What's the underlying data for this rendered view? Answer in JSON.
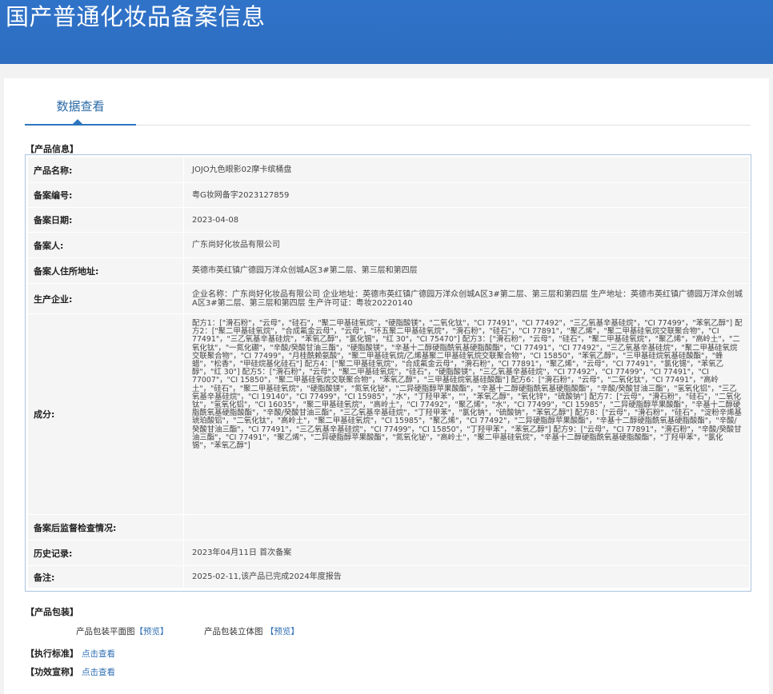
{
  "header": {
    "title": "国产普通化妆品备案信息"
  },
  "tab": {
    "label": "数据查看"
  },
  "sections": {
    "product_info": "【产品信息】",
    "packaging": "【产品包装】",
    "exec_standard": "【执行标准】",
    "efficacy": "【功效宣称】"
  },
  "rows": [
    {
      "label": "产品名称:",
      "value": "JOJO九色眼影02摩卡缤桶盘"
    },
    {
      "label": "备案编号:",
      "value": "粤G妆网备字2023127859"
    },
    {
      "label": "备案日期:",
      "value": "2023-04-08"
    },
    {
      "label": "备案人:",
      "value": "广东尚好化妆品有限公司"
    },
    {
      "label": "备案人住所地址:",
      "value": "英德市英红镇广德园万洋众创城A区3#第二层、第三层和第四层"
    },
    {
      "label": "生产企业:",
      "value": "企业名称：广东尚好化妆品有限公司 企业地址：英德市英红镇广德园万洋众创城A区3#第二层、第三层和第四层 生产地址：英德市英红镇广德园万洋众创城A区3#第二层、第三层和第四层 生产许可证：粤妆20220140"
    },
    {
      "label": "成分:",
      "value": "配方1：[\"滑石粉\"，\"云母\"，\"硅石\"，\"聚二甲基硅氧烷\"，\"硬脂酸镁\"，\"二氧化钛\"，\"CI 77491\"，\"CI 77492\"，\"三乙氧基辛基硅烷\"，\"CI 77499\"，\"苯氧乙醇\"] 配方2：[\"聚二甲基硅氧烷\"，\"合成氟金云母\"，\"云母\"，\"环五聚二甲基硅氧烷\"，\"滑石粉\"，\"硅石\"，\"CI 77891\"，\"聚乙烯\"，\"聚二甲基硅氧烷交联聚合物\"，\"CI 77491\"，\"三乙氧基辛基硅烷\"，\"苯氧乙醇\"，\"氯化锡\"，\"红 30\"，\"CI 75470\"] 配方3：[\"滑石粉\"，\"云母\"，\"硅石\"，\"聚二甲基硅氧烷\"，\"聚乙烯\"，\"高岭土\"，\"二氧化钛\"，\"一氮化硼\"，\"辛酸/癸酸甘油三酯\"，\"硬脂酸镁\"，\"辛基十二醇硬脂酰氧基硬脂酸酯\"，\"CI 77491\"，\"CI 77492\"，\"三乙氧基辛基硅烷\"，\"聚二甲基硅氧烷交联聚合物\"，\"CI 77499\"，\"月桂酰赖氨酸\"，\"聚二甲基硅氧烷/乙烯基聚二甲基硅氧烷交联聚合物\"，\"CI 15850\"，\"苯氧乙醇\"，\"三甲基硅烷氧基硅酸酯\"，\"蜂蜡\"，\"松香\"，\"甲硅烷基化硅石\"] 配方4：[\"聚二甲基硅氧烷\"，\"合成氟金云母\"，\"滑石粉\"，\"CI 77891\"，\"聚乙烯\"，\"云母\"，\"CI 77491\"，\"氯化锡\"，\"苯氧乙醇\"，\"红 30\"] 配方5：[\"滑石粉\"，\"云母\"，\"聚二甲基硅氧烷\"，\"硅石\"，\"硬脂酸镁\"，\"三乙氧基辛基硅烷\"，\"CI 77492\"，\"CI 77499\"，\"CI 77491\"，\"CI 77007\"，\"CI 15850\"，\"聚二甲基硅氧烷交联聚合物\"，\"苯氧乙醇\"，\"三甲基硅烷氧基硅酸酯\"] 配方6：[\"滑石粉\"，\"云母\"，\"二氧化钛\"，\"CI 77491\"，\"高岭土\"，\"硅石\"，\"聚二甲基硅氧烷\"，\"硬脂酸镁\"，\"氮氧化铋\"，\"二异硬脂醇苹果酸酯\"，\"辛基十二醇硬脂酰氧基硬脂酸酯\"，\"辛酸/癸酸甘油三酯\"，\"氢氧化铝\"，\"三乙氧基辛基硅烷\"，\"CI 19140\"，\"CI 77499\"，\"CI 15985\"，\"水\"，\"丁羟甲苯\"，\"\"，\"苯氧乙醇\"，\"氧化锌\"，\"硫酸钠\"] 配方7：[\"云母\"，\"滑石粉\"，\"硅石\"，\"二氧化钛\"，\"氢氧化铝\"，\"CI 16035\"，\"聚二甲基硅氧烷\"，\"高岭土\"，\"CI 77492\"，\"聚乙烯\"，\"水\"，\"CI 77499\"，\"CI 15985\"，\"二异硬脂醇苹果酸酯\"，\"辛基十二醇硬脂酰氧基硬脂酸酯\"，\"辛酸/癸酸甘油三酯\"，\"三乙氧基辛基硅烷\"，\"丁羟甲苯\"，\"氯化钠\"，\"硫酸钠\"，\"苯氧乙醇\"] 配方8：[\"云母\"，\"滑石粉\"，\"硅石\"，\"淀粉辛烯基琥珀酸铝\"，\"二氧化钛\"，\"高岭土\"，\"聚二甲基硅氧烷\"，\"CI 15985\"，\"聚乙烯\"，\"CI 77492\"，\"二异硬脂醇苹果酸酯\"，\"辛基十二醇硬脂酰氧基硬脂酸酯\"，\"辛酸/癸酸甘油三酯\"，\"CI 77491\"，\"三乙氧基辛基硅烷\"，\"CI 77499\"，\"CI 15850\"，\"丁羟甲苯\"，\"苯氧乙醇\"] 配方9：[\"云母\"，\"CI 77891\"，\"滑石粉\"，\"辛酸/癸酸甘油三酯\"，\"CI 77491\"，\"聚乙烯\"，\"二异硬脂醇苹果酸酯\"，\"氮氧化铋\"，\"高岭土\"，\"聚二甲基硅氧烷\"，\"辛基十二醇硬脂酰氧基硬脂酸酯\"，\"丁羟甲苯\"，\"氯化锡\"，\"苯氧乙醇\"]"
    },
    {
      "label": "备案后监督检查情况:",
      "value": ""
    },
    {
      "label": "历史记录:",
      "value": "2023年04月11日 首次备案"
    },
    {
      "label": "备注:",
      "value": "2025-02-11,该产品已完成2024年度报告"
    }
  ],
  "packaging": {
    "flat_label": "产品包装平面图",
    "flat_link": "【预览】",
    "solid_label": "产品包装立体图",
    "solid_link": "【预览】"
  },
  "exec_standard": {
    "link": "点击查看"
  },
  "efficacy": {
    "link": "点击查看"
  }
}
